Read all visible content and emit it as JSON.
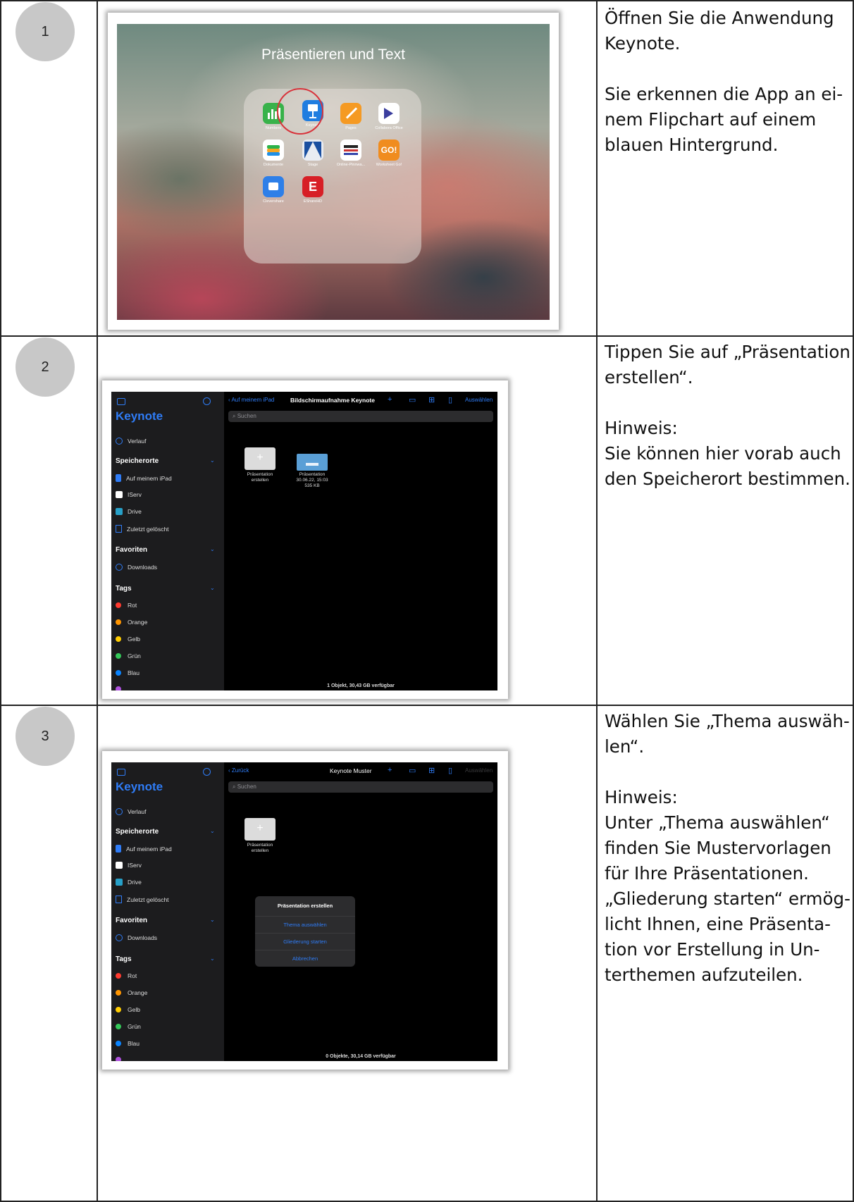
{
  "steps": [
    {
      "number": "1",
      "lines": [
        "Öffnen Sie die Anwendung",
        "Keynote.",
        "",
        "Sie erkennen die App an ei-",
        "nem Flipchart auf einem",
        "blauen Hintergrund."
      ],
      "screenshot": {
        "folder_title": "Präsentieren und Text",
        "apps": [
          {
            "label": "Numbers",
            "icon": "numbers-icon",
            "color": "#38b24a"
          },
          {
            "label": "Keynote",
            "icon": "keynote-icon",
            "color": "#1f7de0"
          },
          {
            "label": "Pages",
            "icon": "pages-icon",
            "color": "#f59a23"
          },
          {
            "label": "Collabora Office",
            "icon": "collabora-icon",
            "color": "#ffffff"
          },
          {
            "label": "Dokumente",
            "icon": "documents-icon",
            "color": "#1f8fe6"
          },
          {
            "label": "Stage",
            "icon": "stage-icon",
            "color": "#e9ecf2"
          },
          {
            "label": "Online-Pinnwa...",
            "icon": "pinboard-icon",
            "color": "#ffffff"
          },
          {
            "label": "Worksheet Go!",
            "icon": "worksheet-go-icon",
            "color": "#f08c1e"
          },
          {
            "label": "Clevershare",
            "icon": "clevershare-icon",
            "color": "#2e7fe8"
          },
          {
            "label": "EShareHD",
            "icon": "esharehd-icon",
            "color": "#d71f26"
          }
        ]
      }
    },
    {
      "number": "2",
      "lines": [
        "Tippen Sie auf „Präsentation",
        "erstellen“.",
        "",
        "Hinweis:",
        "Sie können hier vorab auch",
        "den Speicherort bestimmen."
      ],
      "screenshot": {
        "back_label": "Auf meinem iPad",
        "folder_title": "Bildschirmaufnahme Keynote",
        "select_label": "Auswählen",
        "search_placeholder": "Suchen",
        "new_tile": [
          "Präsentation",
          "erstellen"
        ],
        "file": {
          "name": "Präsentation",
          "date": "30.06.22, 15:03",
          "size": "535 KB"
        },
        "footer": "1 Objekt, 30,43 GB verfügbar"
      }
    },
    {
      "number": "3",
      "lines": [
        "Wählen Sie „Thema auswäh-",
        "len“.",
        "",
        "Hinweis:",
        "Unter „Thema auswählen“",
        "finden Sie Mustervorlagen",
        "für Ihre Präsentationen.",
        "„Gliederung starten“ ermög-",
        "licht Ihnen, eine Präsenta-",
        "tion vor Erstellung in Un-",
        "terthemen aufzuteilen."
      ],
      "screenshot": {
        "back_label": "Zurück",
        "folder_title": "Keynote Muster",
        "select_label": "Auswählen",
        "search_placeholder": "Suchen",
        "new_tile": [
          "Präsentation",
          "erstellen"
        ],
        "sheet": {
          "title": "Präsentation erstellen",
          "options": [
            "Thema auswählen",
            "Gliederung starten",
            "Abbrechen"
          ]
        },
        "footer": "0 Objekte, 30,14 GB verfügbar"
      }
    }
  ],
  "sidebar": {
    "app_name": "Keynote",
    "recents": "Verlauf",
    "locations_header": "Speicherorte",
    "locations": [
      "Auf meinem iPad",
      "IServ",
      "Drive",
      "Zuletzt gelöscht"
    ],
    "favorites_header": "Favoriten",
    "favorites": [
      "Downloads"
    ],
    "tags_header": "Tags",
    "tags": [
      {
        "label": "Rot",
        "color": "#ff3b30"
      },
      {
        "label": "Orange",
        "color": "#ff9500"
      },
      {
        "label": "Gelb",
        "color": "#ffcc00"
      },
      {
        "label": "Grün",
        "color": "#34c759"
      },
      {
        "label": "Blau",
        "color": "#0a84ff"
      }
    ]
  },
  "colors": {
    "accent": "#2f7cf6",
    "highlight_ring": "#d8333b"
  }
}
